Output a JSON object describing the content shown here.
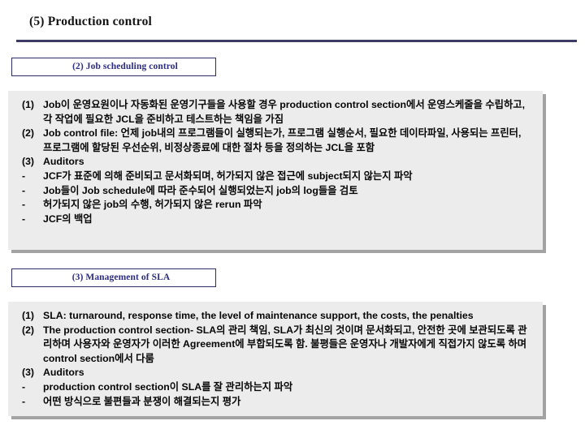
{
  "slide": {
    "title": "(5) Production control"
  },
  "sections": [
    {
      "header": "(2) Job scheduling control",
      "items": [
        {
          "marker": "(1)",
          "text": "Job이 운영요원이나 자동화된 운영기구들을 사용할 경우 production control section에서 운영스케줄을 수립하고, 각 작업에 필요한 JCL을 준비하고 테스트하는 책임을 가짐"
        },
        {
          "marker": "(2)",
          "text": "Job control file: 언제 job내의 프로그램들이 실행되는가, 프로그램 실행순서, 필요한 데이타파일, 사용되는 프린터, 프로그램에 할당된 우선순위, 비정상종료에 대한 절차 등을 정의하는 JCL을 포함"
        },
        {
          "marker": "(3)",
          "text": "Auditors"
        },
        {
          "marker": "-",
          "text": "JCF가 표준에 의해 준비되고 문서화되며, 허가되지 않은 접근에 subject되지 않는지 파악"
        },
        {
          "marker": "-",
          "text": "Job들이 Job schedule에 따라 준수되어 실행되었는지 job의 log들을 검토"
        },
        {
          "marker": "-",
          "text": "허가되지 않은 job의 수행, 허가되지 않은 rerun 파악"
        },
        {
          "marker": "-",
          "text": "JCF의 백업"
        }
      ]
    },
    {
      "header": "(3) Management of SLA",
      "items": [
        {
          "marker": "(1)",
          "text": "SLA: turnaround, response time, the level of maintenance support, the costs, the penalties"
        },
        {
          "marker": "(2)",
          "text": "The production control section- SLA의 관리 책임, SLA가 최신의 것이며 문서화되고, 안전한 곳에 보관되도록 관리하며 사용자와 운영자가 이러한 Agreement에 부합되도록 함. 불평들은 운영자나 개발자에게 직접가지 않도록 하며 control section에서 다룸"
        },
        {
          "marker": "(3)",
          "text": "Auditors"
        },
        {
          "marker": "-",
          "text": "production control section이 SLA를 잘 관리하는지 파악"
        },
        {
          "marker": "-",
          "text": "어떤 방식으로 불편들과 분쟁이 해결되는지 평가"
        }
      ]
    }
  ],
  "colors": {
    "rule": "#3b3b63",
    "header_text": "#2c2c80",
    "header_border": "#2d2d66",
    "box_bg": "#ececec",
    "box_shadow": "#a3a3a3",
    "body_text": "#050505"
  }
}
